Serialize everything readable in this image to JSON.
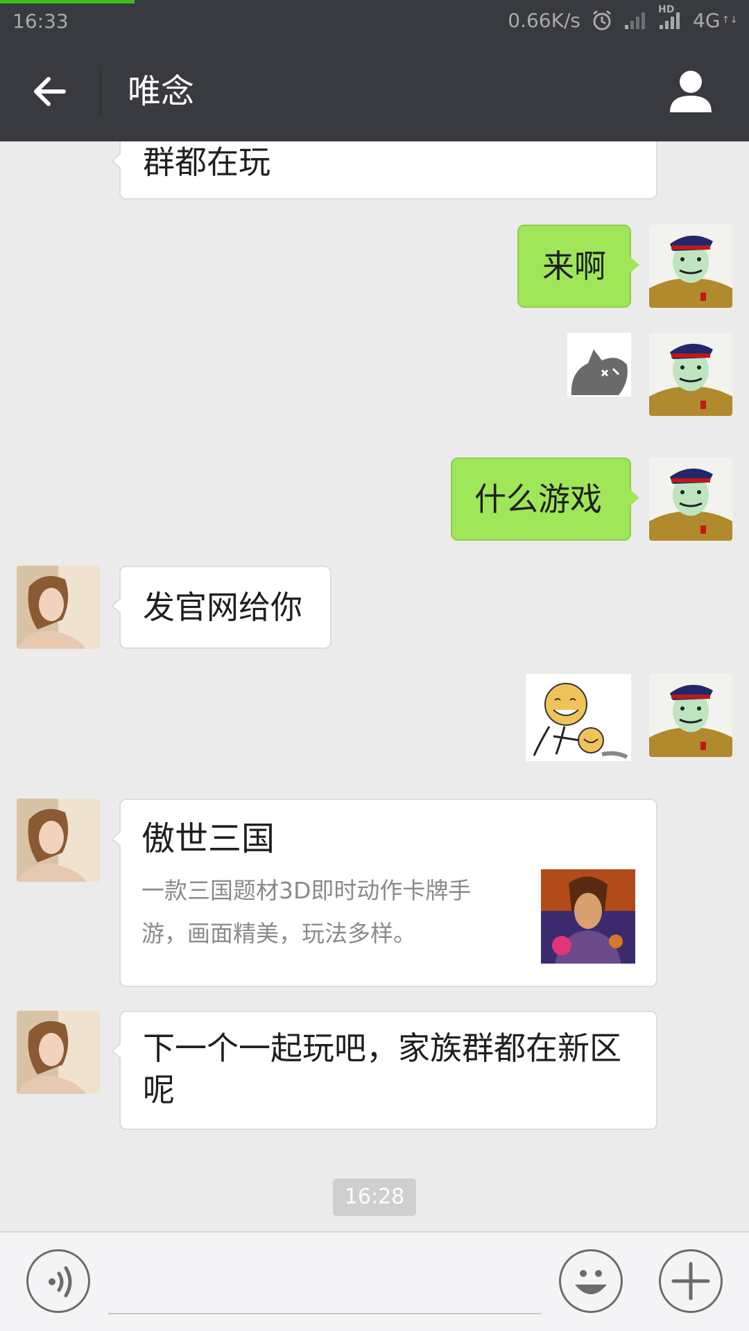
{
  "status_bar": {
    "time": "16:33",
    "net_speed": "0.66K/s",
    "hd_label": "HD",
    "network": "4G",
    "network_arrows": "↑↓"
  },
  "header": {
    "title": "唯念"
  },
  "chat": {
    "messages": [
      {
        "direction": "in",
        "type": "text",
        "text": "群都在玩"
      },
      {
        "direction": "out",
        "type": "text",
        "text": "来啊"
      },
      {
        "direction": "out",
        "type": "sticker",
        "sticker": "gray-cat-sticker"
      },
      {
        "direction": "out",
        "type": "text",
        "text": "什么游戏"
      },
      {
        "direction": "in",
        "type": "text",
        "text": "发官网给你"
      },
      {
        "direction": "out",
        "type": "sticker",
        "sticker": "laughing-face-sticker"
      },
      {
        "direction": "in",
        "type": "card",
        "title": "傲世三国",
        "description_lines": [
          "一款三国题材3D即时动作卡牌手",
          "游，画面精美，玩法多样。"
        ]
      },
      {
        "direction": "in",
        "type": "text",
        "lines": [
          "下一个一起玩吧，家族群都在新区",
          "呢"
        ]
      }
    ],
    "timestamp": "16:28"
  },
  "input_bar": {
    "voice_icon": "voice-icon",
    "emoji_icon": "emoji-icon",
    "more_icon": "plus-icon",
    "text_value": ""
  },
  "colors": {
    "header_bg": "#393a3f",
    "chat_bg": "#ebebeb",
    "outgoing_bubble": "#9fe658",
    "incoming_bubble": "#ffffff",
    "progress": "#3fbf1f"
  }
}
